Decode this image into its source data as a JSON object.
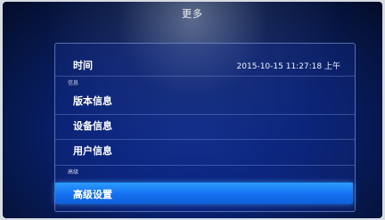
{
  "screen": {
    "title": "更多"
  },
  "menu": {
    "time_row": {
      "label": "时间",
      "value": "2015-10-15 11:27:18 上午"
    },
    "section_info": "信息",
    "info_items": [
      {
        "label": "版本信息"
      },
      {
        "label": "设备信息"
      },
      {
        "label": "用户信息"
      }
    ],
    "section_advanced": "高级",
    "advanced_item": {
      "label": "高级设置",
      "selected": true
    }
  },
  "colors": {
    "screen_background": "#08206e",
    "highlight": "#1570f0",
    "text": "#ffffff"
  }
}
